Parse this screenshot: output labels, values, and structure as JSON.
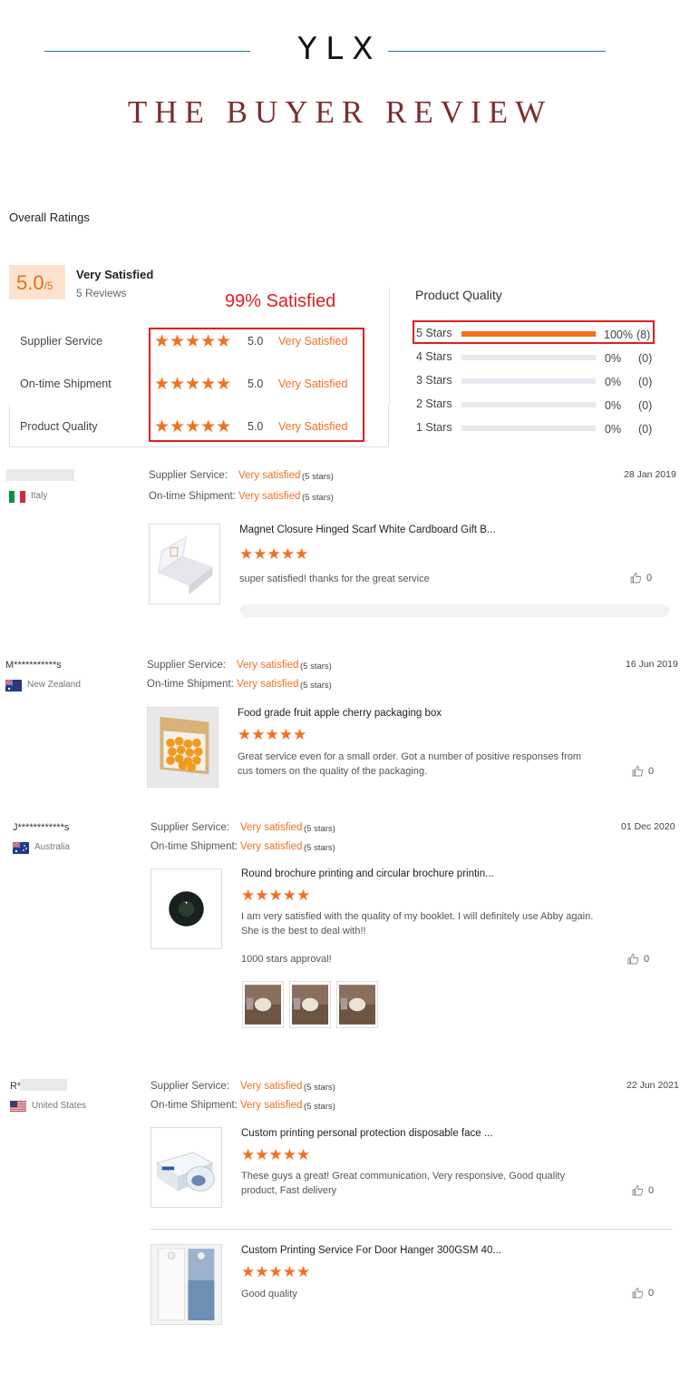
{
  "brand": "YLX",
  "page_title": "THE BUYER REVIEW",
  "overall": {
    "heading": "Overall Ratings",
    "score": "5.0",
    "score_suffix": "/5",
    "label": "Very Satisfied",
    "reviews_count": "5 Reviews",
    "satisfied_banner": "99% Satisfied",
    "metrics": [
      {
        "name": "Supplier Service",
        "value": "5.0",
        "text": "Very Satisfied"
      },
      {
        "name": "On-time Shipment",
        "value": "5.0",
        "text": "Very Satisfied"
      },
      {
        "name": "Product Quality",
        "value": "5.0",
        "text": "Very Satisfied"
      }
    ]
  },
  "histogram": {
    "title": "Product Quality",
    "rows": [
      {
        "label": "5 Stars",
        "percent": "100%",
        "count": "(8)",
        "fraction": 1.0
      },
      {
        "label": "4 Stars",
        "percent": "0%",
        "count": "(0)",
        "fraction": 0
      },
      {
        "label": "3 Stars",
        "percent": "0%",
        "count": "(0)",
        "fraction": 0
      },
      {
        "label": "2 Stars",
        "percent": "0%",
        "count": "(0)",
        "fraction": 0
      },
      {
        "label": "1 Stars",
        "percent": "0%",
        "count": "(0)",
        "fraction": 0
      }
    ]
  },
  "review_labels": {
    "supplier": "Supplier Service:",
    "shipment": "On-time Shipment:",
    "very_satisfied": "Very satisfied",
    "five_stars": "(5 stars)",
    "star_glyphs": "★★★★★"
  },
  "reviews": [
    {
      "name": "",
      "country": "Italy",
      "date": "28 Jan 2019",
      "products": [
        {
          "title": "Magnet Closure Hinged Scarf White Cardboard Gift B...",
          "comment": "super satisfied! thanks for the great service",
          "likes": "0"
        }
      ]
    },
    {
      "name": "M***********s",
      "country": "New Zealand",
      "date": "16 Jun 2019",
      "products": [
        {
          "title": "Food grade fruit apple cherry packaging box",
          "comment": "Great service even for a small order. Got a number of positive responses from cus tomers on the quality of the packaging.",
          "likes": "0"
        }
      ]
    },
    {
      "name": "J************s",
      "country": "Australia",
      "date": "01 Dec 2020",
      "products": [
        {
          "title": "Round brochure printing and circular brochure printin...",
          "comment": "I am very satisfied with the quality of my booklet. I will definitely use Abby again. She is the best to deal with!!",
          "extra": "1000 stars approval!",
          "likes": "0"
        }
      ]
    },
    {
      "name": "R*",
      "country": "United States",
      "date": "22 Jun 2021",
      "products": [
        {
          "title": "Custom printing personal protection disposable face ...",
          "comment": "These guys a great! Great communication, Very responsive, Good quality product, Fast delivery",
          "likes": "0"
        },
        {
          "title": "Custom Printing Service For Door Hanger 300GSM 40...",
          "comment": "Good quality",
          "likes": "0"
        }
      ]
    }
  ],
  "colors": {
    "accent": "#f37021",
    "title": "#7a2e2e",
    "highlight_box": "#e11e1e",
    "rule": "#1e7d86"
  }
}
